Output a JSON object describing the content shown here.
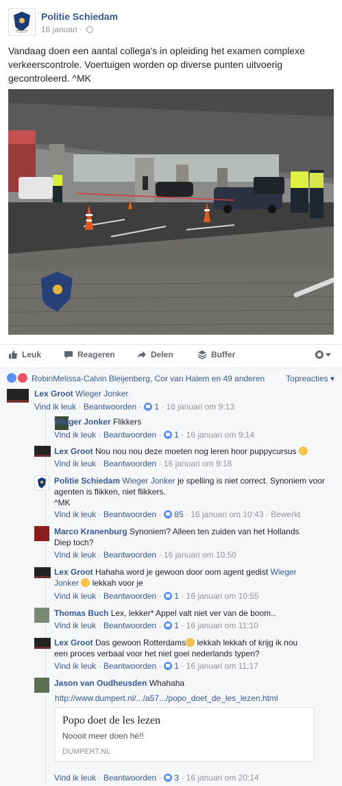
{
  "post": {
    "page_name": "Politie Schiedam",
    "date": "16 januari",
    "separator": "·",
    "text": "Vandaag doen een aantal collega's in opleiding het examen complexe verkeerscontrole. Voertuigen worden op diverse punten uitvoerig gecontroleerd. ^MK"
  },
  "actions": {
    "like": "Leuk",
    "comment": "Reageren",
    "share": "Delen",
    "buffer": "Buffer"
  },
  "reactions": {
    "names": "RobinMelissa-Calvin Bleijenberg, Cor van Halem en 49 anderen",
    "top_label": "Topreacties"
  },
  "comment_actions": {
    "like": "Vind ik leuk",
    "reply": "Beantwoorden",
    "dot": "·",
    "edited": "Bewerkt"
  },
  "comments": [
    {
      "author": "Lex Groot",
      "tag": "Wieger Jonker",
      "text": "",
      "likes": "1",
      "time": "16 januari om 9:13"
    },
    {
      "author": "Wieger Jonker",
      "tag": "",
      "text": "Flikkers",
      "likes": "1",
      "time": "16 januari om 9:14"
    },
    {
      "author": "Lex Groot",
      "tag": "",
      "text": "Nou nou nou deze moeten nog leren hoor puppycursus",
      "likes": "",
      "time": "16 januari om 9:18"
    },
    {
      "author": "Politie Schiedam",
      "tag": "Wieger Jonker",
      "text": "je spelling is niet correct. Synoniem voor agenten is flikken, niet flikkers.",
      "text2": "^MK",
      "likes": "85",
      "time": "16 januari om 10:43"
    },
    {
      "author": "Marco Kranenburg",
      "tag": "",
      "text": "Synoniem? Alleen ten zuiden van het Hollands Diep toch?",
      "likes": "",
      "time": "16 januari om 10:50"
    },
    {
      "author": "Lex Groot",
      "tag": "",
      "text": "Hahaha word je gewoon door oom agent gedist",
      "tag2": "Wieger Jonker",
      "text2": "lekkah voor je",
      "likes": "1",
      "time": "16 januari om 10:55"
    },
    {
      "author": "Thomas Buch",
      "tag": "",
      "text": "Lex, lekker* Appel valt niet ver van de boom..",
      "likes": "1",
      "time": "16 januari om 11:10"
    },
    {
      "author": "Lex Groot",
      "tag": "",
      "text": "Das gewoon Rotterdams",
      "text2": "lekkah lekkah of krijg ik nou een proces verbaal voor het niet goei nederlands typen?",
      "likes": "1",
      "time": "16 januari om 11:17"
    },
    {
      "author": "Jason van Oudheusden",
      "tag": "",
      "text": "Whahaha",
      "likes": "3",
      "time": "16 januari om 20:14"
    }
  ],
  "link": {
    "url": "http://www.dumpert.nl/.../a57.../popo_doet_de_les_lezen.html",
    "title": "Popo doet de les lezen",
    "description": "Noooit meer doen hé!!",
    "domain": "DUMPERT.NL"
  },
  "colors": {
    "link": "#365899",
    "meta": "#90949c",
    "like_blue": "#5890ff",
    "love_red": "#f25268"
  }
}
